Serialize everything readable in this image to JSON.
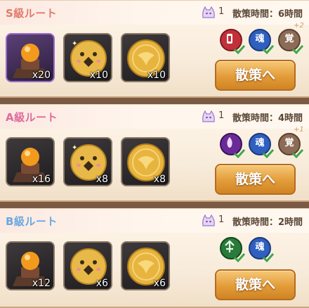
{
  "routes": [
    {
      "name": "S級ルート",
      "count": "1",
      "time": "散策時間：6時間",
      "items": [
        {
          "icon": "amber-orb-stand-icon",
          "qty": "x20"
        },
        {
          "icon": "face-coin-icon",
          "qty": "x10"
        },
        {
          "icon": "gold-emblem-coin-icon",
          "qty": "x10"
        }
      ],
      "badges": [
        {
          "icon": "red-crest-icon",
          "label": "",
          "color": "#c2303a"
        },
        {
          "icon": "blue-soul-icon",
          "label": "魂",
          "color": "#2f5fbf"
        },
        {
          "icon": "tan-awaken-icon",
          "label": "覚",
          "color": "#8c6c56"
        }
      ],
      "plus": "+2",
      "button": "散策へ"
    },
    {
      "name": "A級ルート",
      "count": "1",
      "time": "散策時間：4時間",
      "items": [
        {
          "icon": "amber-orb-stand-icon",
          "qty": "x16"
        },
        {
          "icon": "face-coin-icon",
          "qty": "x8"
        },
        {
          "icon": "gold-emblem-coin-icon",
          "qty": "x8"
        }
      ],
      "badges": [
        {
          "icon": "purple-flame-icon",
          "label": "",
          "color": "#6a2a98"
        },
        {
          "icon": "blue-soul-icon",
          "label": "魂",
          "color": "#2f5fbf"
        },
        {
          "icon": "tan-awaken-icon",
          "label": "覚",
          "color": "#8c6c56"
        }
      ],
      "plus": "+1",
      "button": "散策へ"
    },
    {
      "name": "B級ルート",
      "count": "1",
      "time": "散策時間：2時間",
      "items": [
        {
          "icon": "amber-orb-stand-icon",
          "qty": "x12"
        },
        {
          "icon": "face-coin-icon",
          "qty": "x6"
        },
        {
          "icon": "gold-emblem-coin-icon",
          "qty": "x6"
        }
      ],
      "badges": [
        {
          "icon": "green-arrow-icon",
          "label": "",
          "color": "#2a7a3a"
        },
        {
          "icon": "blue-soul-icon",
          "label": "魂",
          "color": "#2f5fbf"
        }
      ],
      "plus": "",
      "button": "散策へ"
    }
  ]
}
